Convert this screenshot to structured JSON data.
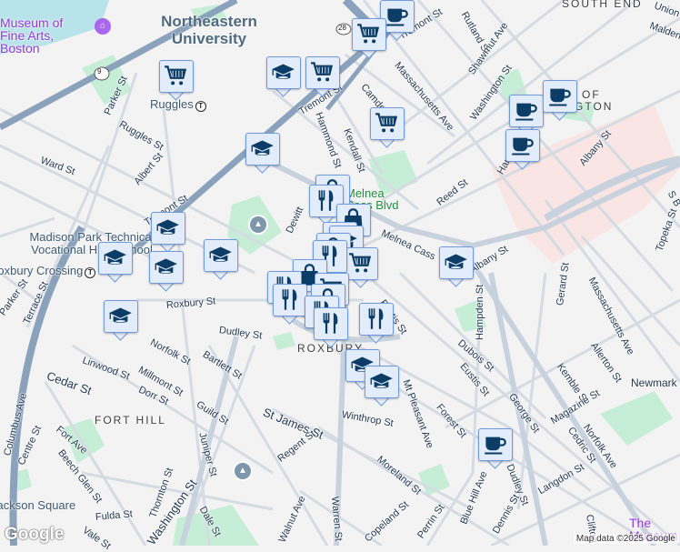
{
  "map": {
    "places": {
      "mfa": "Museum of Fine Arts, Boston",
      "northeastern": "Northeastern University",
      "ruggles": "Ruggles",
      "madison_park": "Madison Park Technical Vocational High School",
      "roxbury_crossing": "Roxbury Crossing",
      "melnea_cass_blvd": "Melnea Cass Blvd",
      "jackson_square": "Jackson Square",
      "museum_right": "The Museum",
      "bmc_a": "OF",
      "bmc_b": "GTON"
    },
    "neighborhoods": [
      "SOUTH END",
      "ROXBURY",
      "FORT HILL"
    ],
    "streets": {
      "parker1": "Parker St",
      "ruggles": "Ruggles St",
      "ward": "Ward St",
      "albert": "Albert St",
      "tremont1": "Tremont St",
      "tremont2": "Tremont St",
      "tremont3": "Tremont St",
      "hammond": "Hammond St",
      "dewitt": "Dewitt",
      "camden": "Camden St",
      "kendall": "Kendall St",
      "rutland": "Rutland St",
      "shawmut": "Shawmut Ave",
      "washington1": "Washington St",
      "mass1": "Massachusetts Ave",
      "harrison": "Harrison Ave",
      "albany1": "Albany St",
      "albany2": "Albany St",
      "reed": "Reed St",
      "melnea": "Melnea Cass",
      "union": "Union",
      "malden": "Malden",
      "topeka": "Topeka St",
      "sb": "S B",
      "mass2": "Massachusetts Ave",
      "gerard": "Gerard St",
      "allerton": "Allerton St",
      "kemble": "Kemble St",
      "newmarket": "Newmark",
      "magazine": "Magazine St",
      "norfolk_ave": "Norfolk Ave",
      "cedric": "Cedric St",
      "george": "George St",
      "hampden": "Hampden St",
      "dubois": "Dubois St",
      "eustis1": "Eustis St",
      "eustis2": "Eustis St",
      "forest": "Forest St",
      "mt_pleasant": "Mt Pleasant Ave",
      "winthrop": "Winthrop St",
      "moreland": "Moreland St",
      "blue_hill": "Blue Hill Ave",
      "dudley1": "Dudley St",
      "dudley2": "Dudley St",
      "dennis": "Dennis St",
      "langdon": "Langdon St",
      "clifton": "Clifton",
      "perrin": "Perrin St",
      "copeland": "Copeland St",
      "warren": "Warren St",
      "walnut": "Walnut Ave",
      "roxbury": "Roxbury St",
      "norfolk_st": "Norfolk St",
      "bartlett": "Bartlett St",
      "linwood": "Linwood St",
      "millmont": "Millmont St",
      "dorr": "Dorr St",
      "cedar": "Cedar St",
      "guild": "Guild St",
      "st_james": "St James St",
      "juniper": "Juniper St",
      "regent": "Regent St",
      "fort_ave": "Fort Ave",
      "beech_glen": "Beech Glen St",
      "centre": "Centre St",
      "columbus": "Columbus Ave",
      "parker2": "Parker St",
      "terrace": "Terrace St",
      "thornton": "Thornton St",
      "washington2": "Washington St",
      "dale": "Dale St",
      "fulda": "Fulda St",
      "vale": "Vale St"
    },
    "route_shields": [
      "9",
      "28"
    ],
    "markers": [
      {
        "type": "cafe"
      },
      {
        "type": "cart"
      },
      {
        "type": "cart"
      },
      {
        "type": "school"
      },
      {
        "type": "cart"
      },
      {
        "type": "school"
      },
      {
        "type": "cart"
      },
      {
        "type": "cafe"
      },
      {
        "type": "cafe"
      },
      {
        "type": "cafe"
      },
      {
        "type": "school"
      },
      {
        "type": "school"
      },
      {
        "type": "school"
      },
      {
        "type": "school"
      },
      {
        "type": "school"
      },
      {
        "type": "school"
      },
      {
        "type": "bag"
      },
      {
        "type": "restaurant"
      },
      {
        "type": "bag"
      },
      {
        "type": "bag"
      },
      {
        "type": "school"
      },
      {
        "type": "bag"
      },
      {
        "type": "cart"
      },
      {
        "type": "restaurant"
      },
      {
        "type": "bag"
      },
      {
        "type": "restaurant"
      },
      {
        "type": "cart"
      },
      {
        "type": "restaurant"
      },
      {
        "type": "bag"
      },
      {
        "type": "restaurant"
      },
      {
        "type": "restaurant"
      },
      {
        "type": "school"
      },
      {
        "type": "school"
      },
      {
        "type": "cafe"
      }
    ],
    "attribution": "Map data ©2025 Google",
    "logo": "Google",
    "colors": {
      "marker_fill": "#e3ecfb",
      "marker_border": "#6f9ae0",
      "icon": "#0b3d66",
      "poi_purple": "#9334e6"
    }
  }
}
